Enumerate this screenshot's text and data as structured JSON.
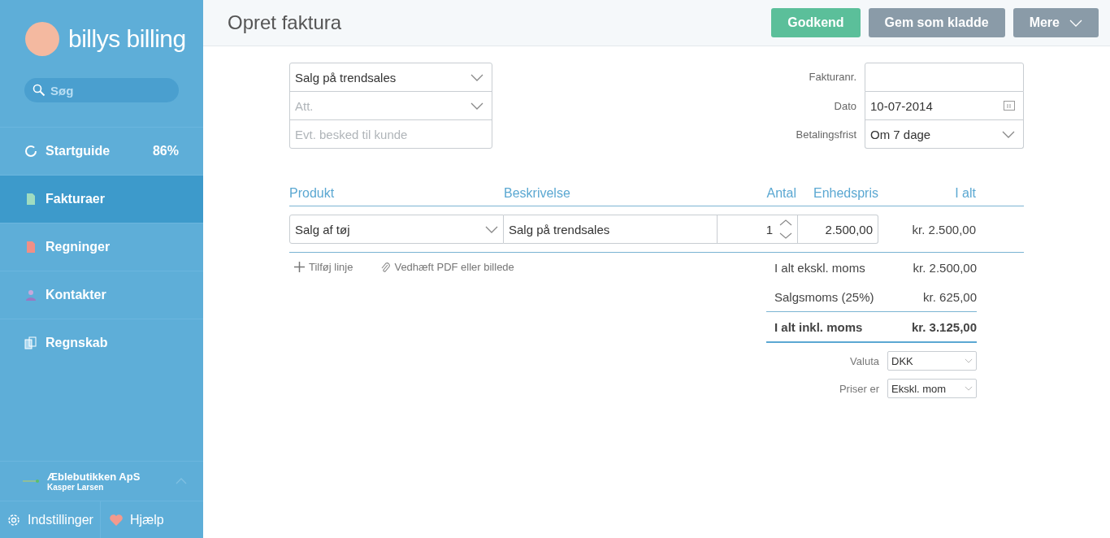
{
  "sidebar": {
    "brand": "billys billing",
    "search": {
      "placeholder": "Søg"
    },
    "nav": [
      {
        "label": "Startguide",
        "badge": "86%",
        "selected": false
      },
      {
        "label": "Fakturaer",
        "selected": true
      },
      {
        "label": "Regninger",
        "selected": false
      },
      {
        "label": "Kontakter",
        "selected": false
      },
      {
        "label": "Regnskab",
        "selected": false
      }
    ],
    "account": {
      "company": "Æblebutikken ApS",
      "user": "Kasper Larsen"
    },
    "footer": [
      {
        "label": "Indstillinger"
      },
      {
        "label": "Hjælp"
      }
    ]
  },
  "header": {
    "title": "Opret faktura",
    "buttons": [
      {
        "label": "Godkend",
        "kind": "primary"
      },
      {
        "label": "Gem som kladde",
        "kind": "secondary"
      },
      {
        "label": "Mere",
        "kind": "dropdown"
      }
    ]
  },
  "customer": {
    "contact": "Salg på trendsales",
    "att_placeholder": "Att.",
    "message_placeholder": "Evt. besked til kunde"
  },
  "meta": [
    {
      "label": "Fakturanr.",
      "kind": "text"
    },
    {
      "label": "Dato",
      "value": "10-07-2014",
      "kind": "date"
    },
    {
      "label": "Betalingsfrist",
      "value": "Om 7 dage",
      "kind": "select"
    }
  ],
  "lines": {
    "columns": [
      "Produkt",
      "Beskrivelse",
      "Antal",
      "Enhedspris",
      "I alt"
    ],
    "rows": [
      {
        "product": "Salg af tøj",
        "description": "Salg på trendsales",
        "quantity": "1",
        "unit_price": "2.500,00",
        "total": "kr. 2.500,00"
      }
    ]
  },
  "actions": [
    "Tilføj linje",
    "Vedhæft PDF eller billede"
  ],
  "totals": [
    {
      "label": "I alt ekskl. moms",
      "value": "kr. 2.500,00",
      "bold": false
    },
    {
      "label": "Salgsmoms (25%)",
      "value": "kr. 625,00",
      "bold": false
    },
    {
      "label": "I alt inkl. moms",
      "value": "kr. 3.125,00",
      "bold": true
    }
  ],
  "options": [
    {
      "label": "Valuta",
      "value": "DKK"
    },
    {
      "label": "Priser er",
      "value": "Ekskl. mom"
    }
  ]
}
